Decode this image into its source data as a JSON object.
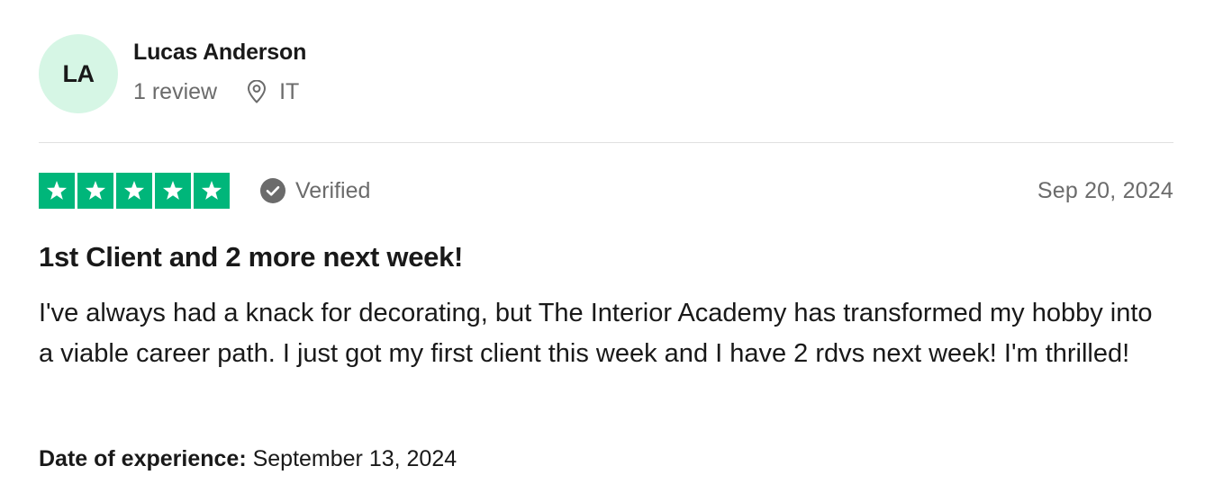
{
  "consumer": {
    "initials": "LA",
    "name": "Lucas Anderson",
    "review_count": "1 review",
    "location": "IT"
  },
  "rating": {
    "stars": 5,
    "max_stars": 5,
    "star_color": "#00b67a",
    "verified_label": "Verified",
    "date": "Sep 20, 2024"
  },
  "review": {
    "title": "1st Client and 2 more next week!",
    "text": "I've always had a knack for decorating, but The Interior Academy has transformed my hobby into a viable career path. I just got my first client this week and I have 2 rdvs next week! I'm thrilled!"
  },
  "experience": {
    "label": "Date of experience:",
    "value": "September 13, 2024"
  },
  "icons": {
    "location": "location-pin-icon",
    "verified": "check-circle-icon",
    "star": "star-icon"
  }
}
